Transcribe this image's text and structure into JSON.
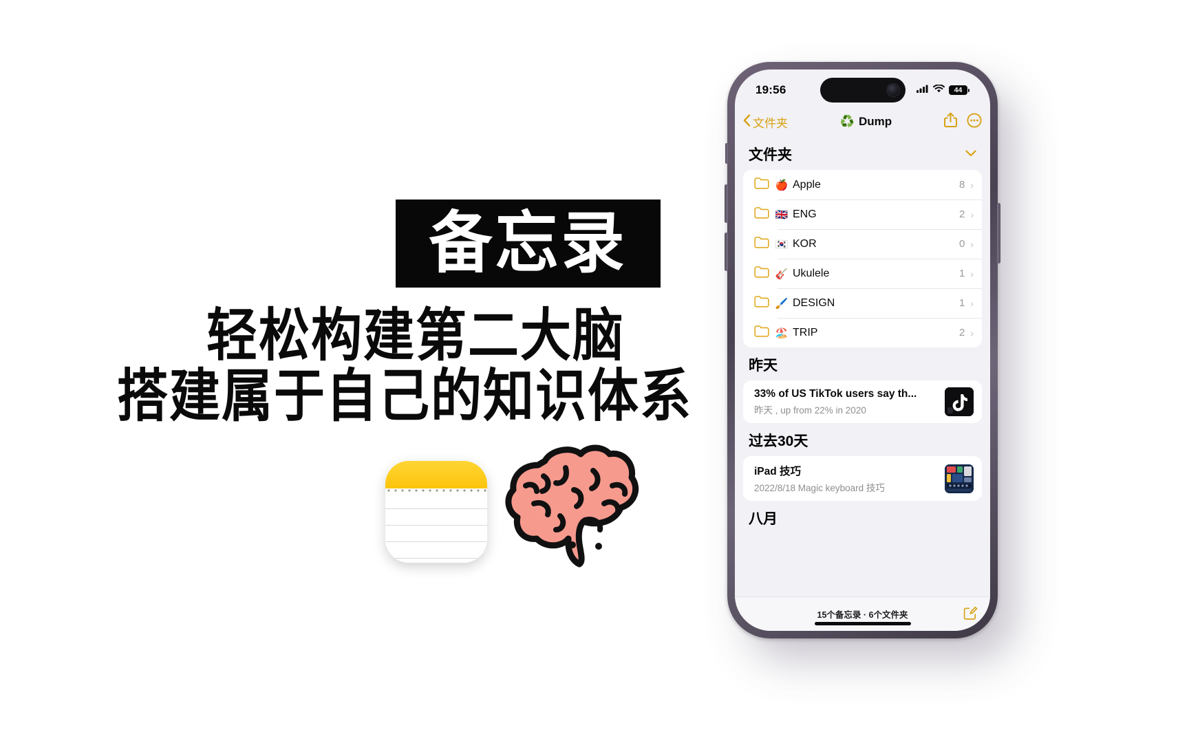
{
  "promo": {
    "title": "备忘录",
    "subtitle_line1": "轻松构建第二大脑",
    "subtitle_line2": "搭建属于自己的知识体系",
    "notes_app_icon": "notes-app-icon",
    "brain_icon": "brain-icon"
  },
  "phone": {
    "status_bar": {
      "time": "19:56",
      "cellular_icon": "cellular-signal-icon",
      "wifi_icon": "wifi-icon",
      "battery_level": "44"
    },
    "nav_bar": {
      "back_label": "文件夹",
      "back_icon": "chevron-left-icon",
      "title_emoji": "♻️",
      "title": "Dump",
      "share_icon": "share-icon",
      "more_icon": "more-circle-icon"
    },
    "folders_section": {
      "header": "文件夹",
      "collapse_icon": "chevron-down-icon",
      "items": [
        {
          "emoji": "🍎",
          "name": "Apple",
          "count": "8"
        },
        {
          "emoji": "🇬🇧",
          "name": "ENG",
          "count": "2"
        },
        {
          "emoji": "🇰🇷",
          "name": "KOR",
          "count": "0"
        },
        {
          "emoji": "🎸",
          "name": "Ukulele",
          "count": "1"
        },
        {
          "emoji": "🖌️",
          "name": "DESIGN",
          "count": "1"
        },
        {
          "emoji": "🏖️",
          "name": "TRIP",
          "count": "2"
        }
      ]
    },
    "note_sections": [
      {
        "header": "昨天",
        "notes": [
          {
            "title": "33% of US TikTok users say th...",
            "subtitle": "昨天  , up from 22% in 2020",
            "thumbnail": "tiktok-thumbnail"
          }
        ]
      },
      {
        "header": "过去30天",
        "notes": [
          {
            "title": "iPad 技巧",
            "subtitle": "2022/8/18  Magic keyboard 技巧",
            "thumbnail": "ipad-thumbnail"
          }
        ]
      },
      {
        "header": "八月",
        "notes": []
      }
    ],
    "toolbar": {
      "summary": "15个备忘录 · 6个文件夹",
      "compose_icon": "compose-note-icon"
    }
  },
  "colors": {
    "accent_yellow": "#d8a215",
    "notes_yellow": "#ffd534",
    "phone_frame": "#594f61",
    "background": "#ffffff"
  }
}
